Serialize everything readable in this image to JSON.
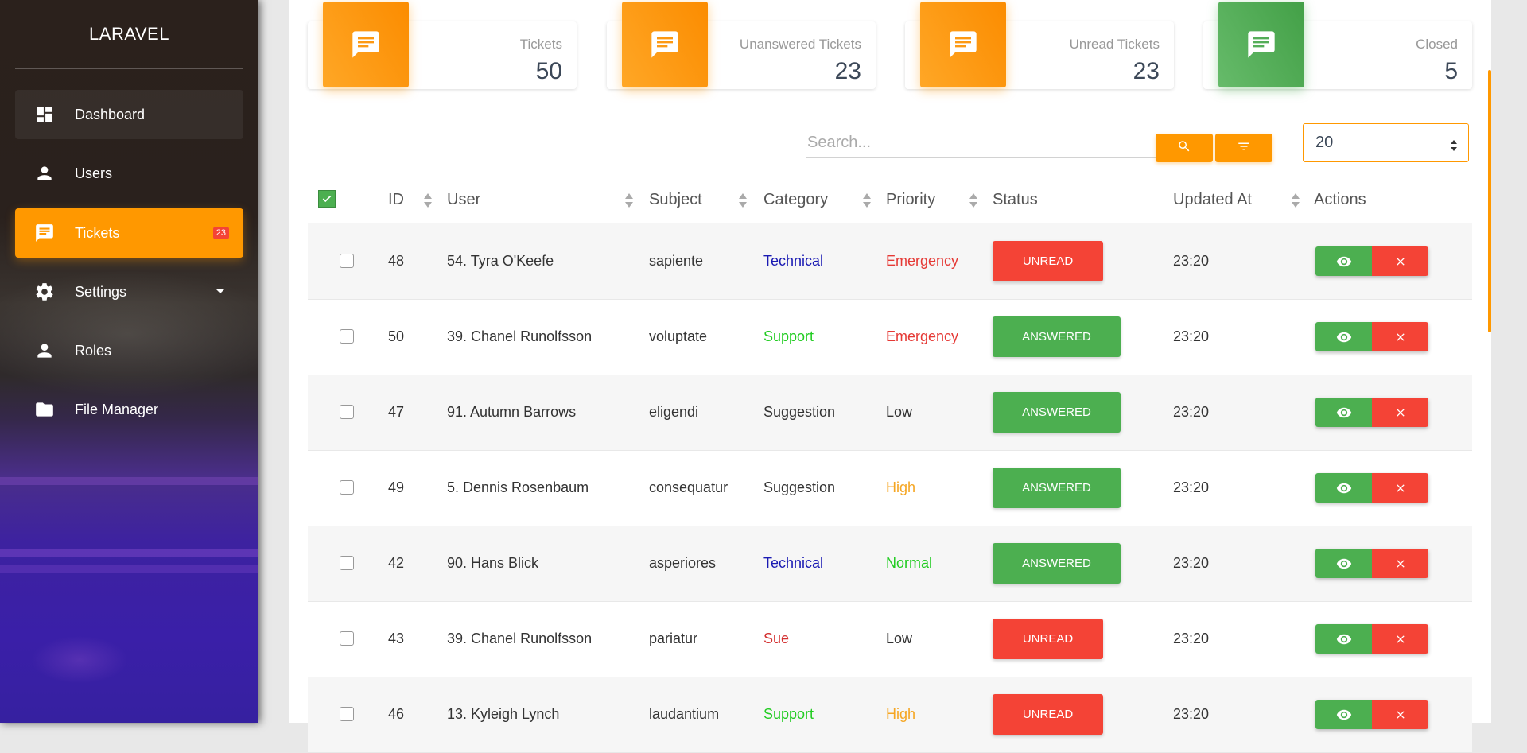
{
  "sidebar": {
    "brand": "LARAVEL",
    "items": [
      {
        "label": "Dashboard",
        "icon": "dashboard-icon"
      },
      {
        "label": "Users",
        "icon": "person-icon"
      },
      {
        "label": "Tickets",
        "icon": "chat-icon",
        "badge": "23"
      },
      {
        "label": "Settings",
        "icon": "gear-icon"
      },
      {
        "label": "Roles",
        "icon": "person-icon"
      },
      {
        "label": "File Manager",
        "icon": "folder-icon"
      }
    ]
  },
  "stats": [
    {
      "label": "Tickets",
      "value": "50",
      "color": "#ff9800"
    },
    {
      "label": "Unanswered Tickets",
      "value": "23",
      "color": "#ff9800"
    },
    {
      "label": "Unread Tickets",
      "value": "23",
      "color": "#ff9800"
    },
    {
      "label": "Closed",
      "value": "5",
      "color": "#4caf50"
    }
  ],
  "toolbar": {
    "search_placeholder": "Search...",
    "per_page": "20"
  },
  "table": {
    "headers": {
      "id": "ID",
      "user": "User",
      "subject": "Subject",
      "category": "Category",
      "priority": "Priority",
      "status": "Status",
      "updated_at": "Updated At",
      "actions": "Actions"
    },
    "rows": [
      {
        "id": "48",
        "user": "54. Tyra O'Keefe",
        "subject": "sapiente",
        "category": "Technical",
        "priority": "Emergency",
        "status": "UNREAD",
        "updated_at": "23:20"
      },
      {
        "id": "50",
        "user": "39. Chanel Runolfsson",
        "subject": "voluptate",
        "category": "Support",
        "priority": "Emergency",
        "status": "ANSWERED",
        "updated_at": "23:20"
      },
      {
        "id": "47",
        "user": "91. Autumn Barrows",
        "subject": "eligendi",
        "category": "Suggestion",
        "priority": "Low",
        "status": "ANSWERED",
        "updated_at": "23:20"
      },
      {
        "id": "49",
        "user": "5. Dennis Rosenbaum",
        "subject": "consequatur",
        "category": "Suggestion",
        "priority": "High",
        "status": "ANSWERED",
        "updated_at": "23:20"
      },
      {
        "id": "42",
        "user": "90. Hans Blick",
        "subject": "asperiores",
        "category": "Technical",
        "priority": "Normal",
        "status": "ANSWERED",
        "updated_at": "23:20"
      },
      {
        "id": "43",
        "user": "39. Chanel Runolfsson",
        "subject": "pariatur",
        "category": "Sue",
        "priority": "Low",
        "status": "UNREAD",
        "updated_at": "23:20"
      },
      {
        "id": "46",
        "user": "13. Kyleigh Lynch",
        "subject": "laudantium",
        "category": "Support",
        "priority": "High",
        "status": "UNREAD",
        "updated_at": "23:20"
      }
    ]
  },
  "colors": {
    "accent": "#ff9800",
    "success": "#4caf50",
    "danger": "#f44336",
    "category_technical": "#1a1ab3",
    "category_support": "#22cc22",
    "category_sue": "#d32f2f",
    "priority_emergency": "#e53935",
    "priority_high": "#f5a623",
    "priority_normal": "#22cc22",
    "text_default": "#333333"
  }
}
